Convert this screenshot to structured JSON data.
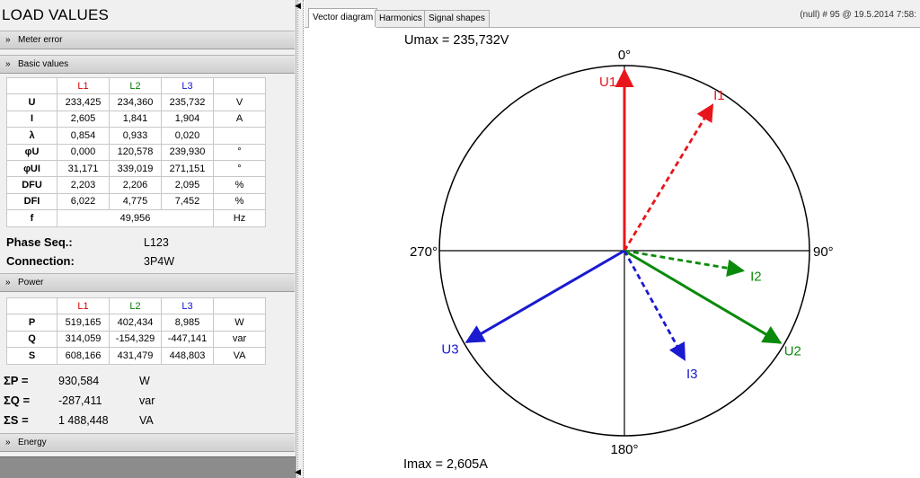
{
  "app": {
    "title": "LOAD VALUES"
  },
  "sections": {
    "meter_error": "Meter error",
    "basic_values": "Basic values",
    "power": "Power",
    "energy": "Energy"
  },
  "basic_table": {
    "headers": [
      "L1",
      "L2",
      "L3"
    ],
    "rows": [
      {
        "label": "U",
        "vals": [
          "233,425",
          "234,360",
          "235,732"
        ],
        "unit": "V"
      },
      {
        "label": "I",
        "vals": [
          "2,605",
          "1,841",
          "1,904"
        ],
        "unit": "A"
      },
      {
        "label": "λ",
        "vals": [
          "0,854",
          "0,933",
          "0,020"
        ],
        "unit": ""
      },
      {
        "label": "φU",
        "vals": [
          "0,000",
          "120,578",
          "239,930"
        ],
        "unit": "°"
      },
      {
        "label": "φUI",
        "vals": [
          "31,171",
          "339,019",
          "271,151"
        ],
        "unit": "°"
      },
      {
        "label": "DFU",
        "vals": [
          "2,203",
          "2,206",
          "2,095"
        ],
        "unit": "%"
      },
      {
        "label": "DFI",
        "vals": [
          "6,022",
          "4,775",
          "7,452"
        ],
        "unit": "%"
      }
    ],
    "freq": {
      "label": "f",
      "value": "49,956",
      "unit": "Hz"
    }
  },
  "phase_seq": {
    "label": "Phase Seq.:",
    "value": "L123"
  },
  "connection": {
    "label": "Connection:",
    "value": "3P4W"
  },
  "power_table": {
    "headers": [
      "L1",
      "L2",
      "L3"
    ],
    "rows": [
      {
        "label": "P",
        "vals": [
          "519,165",
          "402,434",
          "8,985"
        ],
        "unit": "W"
      },
      {
        "label": "Q",
        "vals": [
          "314,059",
          "-154,329",
          "-447,141"
        ],
        "unit": "var"
      },
      {
        "label": "S",
        "vals": [
          "608,166",
          "431,479",
          "448,803"
        ],
        "unit": "VA"
      }
    ]
  },
  "sums": [
    {
      "label": "ΣP =",
      "value": "930,584",
      "unit": "W"
    },
    {
      "label": "ΣQ =",
      "value": "-287,411",
      "unit": "var"
    },
    {
      "label": "ΣS =",
      "value": "1 488,448",
      "unit": "VA"
    }
  ],
  "tabs": [
    {
      "label": "Vector diagram",
      "active": true
    },
    {
      "label": "Harmonics",
      "active": false
    },
    {
      "label": "Signal shapes",
      "active": false
    }
  ],
  "status": "(null) # 95 @ 19.5.2014 7:58:",
  "vector": {
    "umax": "Umax = 235,732V",
    "imax": "Imax = 2,605A",
    "angle_labels": {
      "top": "0°",
      "right": "90°",
      "bottom": "180°",
      "left": "270°"
    },
    "colors": {
      "L1": "#e8161c",
      "L2": "#0a8a0a",
      "L3": "#1a1ad0"
    },
    "phasors": [
      {
        "name": "U1",
        "kind": "voltage",
        "phase": "L1",
        "angle_deg": 0.0,
        "magnitude": 233.425,
        "max": 235.732
      },
      {
        "name": "U2",
        "kind": "voltage",
        "phase": "L2",
        "angle_deg": 120.578,
        "magnitude": 234.36,
        "max": 235.732
      },
      {
        "name": "U3",
        "kind": "voltage",
        "phase": "L3",
        "angle_deg": 239.93,
        "magnitude": 235.732,
        "max": 235.732
      },
      {
        "name": "I1",
        "kind": "current",
        "phase": "L1",
        "angle_deg": 31.171,
        "magnitude": 2.605,
        "max": 2.605
      },
      {
        "name": "I2",
        "kind": "current",
        "phase": "L2",
        "angle_deg": 99.597,
        "magnitude": 1.841,
        "max": 2.605
      },
      {
        "name": "I3",
        "kind": "current",
        "phase": "L3",
        "angle_deg": 151.081,
        "magnitude": 1.904,
        "max": 2.605
      }
    ]
  }
}
